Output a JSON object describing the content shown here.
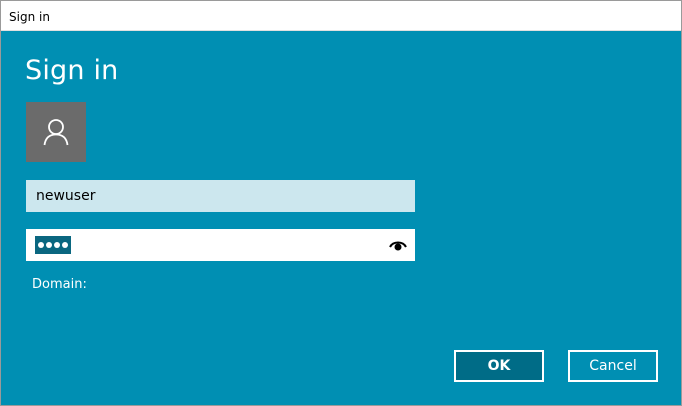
{
  "window": {
    "title": "Sign in"
  },
  "dialog": {
    "heading": "Sign in",
    "avatar_icon": "user-icon"
  },
  "username": {
    "value": "newuser"
  },
  "password": {
    "masked_length": 4,
    "reveal_icon": "eye-icon"
  },
  "domain": {
    "label": "Domain:"
  },
  "buttons": {
    "ok_label": "OK",
    "cancel_label": "Cancel"
  },
  "colors": {
    "background": "#008fb3",
    "avatar": "#6b6b6b",
    "username_field": "#cce7ee",
    "ok_button": "#006c87",
    "selection": "#0a6780"
  }
}
